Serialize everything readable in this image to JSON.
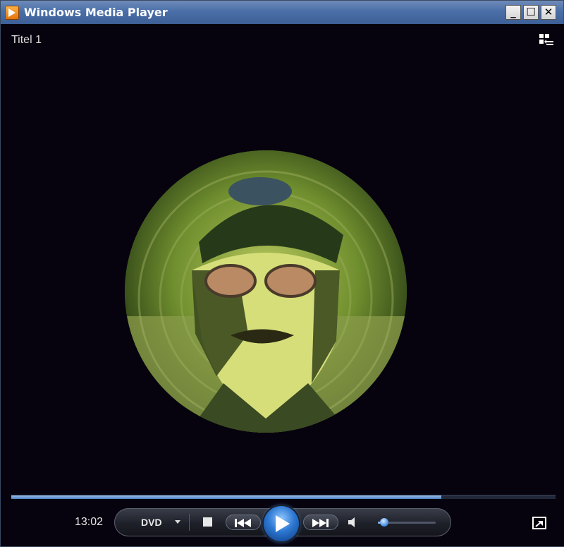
{
  "window": {
    "title": "Windows Media Player",
    "minimize_label": "_",
    "maximize_label": "☐",
    "close_label": "✕"
  },
  "video": {
    "track_title": "Titel 1"
  },
  "playback": {
    "time": "13:02",
    "source_label": "DVD",
    "progress": 0.79,
    "volume": 0.05
  },
  "icons": {
    "app": "media-player-icon",
    "switch_view": "switch-to-library-icon",
    "stop": "stop-icon",
    "previous": "previous-icon",
    "play": "play-icon",
    "next": "next-icon",
    "mute": "speaker-icon",
    "fullscreen": "fullscreen-icon"
  },
  "colors": {
    "titlebar": "#4a6fa8",
    "video_background": "#07030e",
    "accent": "#2d78d2"
  }
}
